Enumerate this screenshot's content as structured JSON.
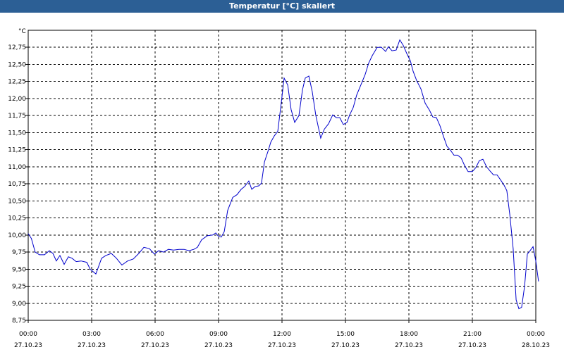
{
  "window": {
    "title": "Temperatur [°C] skaliert"
  },
  "chart_data": {
    "type": "line",
    "title": "Temperatur [°C] skaliert",
    "ylabel": "°C",
    "xlabel": "",
    "ylim": [
      8.75,
      13.0
    ],
    "xlim": [
      0,
      24
    ],
    "grid": true,
    "line_color": "#0000cc",
    "y_ticks": [
      {
        "value": 8.75,
        "label": "8,75"
      },
      {
        "value": 9.0,
        "label": "9,00"
      },
      {
        "value": 9.25,
        "label": "9,25"
      },
      {
        "value": 9.5,
        "label": "9,50"
      },
      {
        "value": 9.75,
        "label": "9,75"
      },
      {
        "value": 10.0,
        "label": "10,00"
      },
      {
        "value": 10.25,
        "label": "10,25"
      },
      {
        "value": 10.5,
        "label": "10,50"
      },
      {
        "value": 10.75,
        "label": "10,75"
      },
      {
        "value": 11.0,
        "label": "11,00"
      },
      {
        "value": 11.25,
        "label": "11,25"
      },
      {
        "value": 11.5,
        "label": "11,50"
      },
      {
        "value": 11.75,
        "label": "11,75"
      },
      {
        "value": 12.0,
        "label": "12,00"
      },
      {
        "value": 12.25,
        "label": "12,25"
      },
      {
        "value": 12.5,
        "label": "12,50"
      },
      {
        "value": 12.75,
        "label": "12,75"
      }
    ],
    "x_ticks": [
      {
        "value": 0,
        "time": "00:00",
        "date": "27.10.23"
      },
      {
        "value": 3,
        "time": "03:00",
        "date": "27.10.23"
      },
      {
        "value": 6,
        "time": "06:00",
        "date": "27.10.23"
      },
      {
        "value": 9,
        "time": "09:00",
        "date": "27.10.23"
      },
      {
        "value": 12,
        "time": "12:00",
        "date": "27.10.23"
      },
      {
        "value": 15,
        "time": "15:00",
        "date": "27.10.23"
      },
      {
        "value": 18,
        "time": "18:00",
        "date": "27.10.23"
      },
      {
        "value": 21,
        "time": "21:00",
        "date": "27.10.23"
      },
      {
        "value": 24,
        "time": "00:00",
        "date": "28.10.23"
      }
    ],
    "series": [
      {
        "points": [
          [
            0.0,
            10.02
          ],
          [
            0.15,
            9.95
          ],
          [
            0.33,
            9.75
          ],
          [
            0.53,
            9.71
          ],
          [
            0.77,
            9.71
          ],
          [
            1.0,
            9.77
          ],
          [
            1.17,
            9.73
          ],
          [
            1.33,
            9.62
          ],
          [
            1.5,
            9.7
          ],
          [
            1.7,
            9.57
          ],
          [
            1.9,
            9.68
          ],
          [
            2.07,
            9.66
          ],
          [
            2.27,
            9.61
          ],
          [
            2.5,
            9.62
          ],
          [
            2.77,
            9.6
          ],
          [
            2.93,
            9.5
          ],
          [
            3.2,
            9.43
          ],
          [
            3.47,
            9.66
          ],
          [
            3.67,
            9.7
          ],
          [
            3.93,
            9.73
          ],
          [
            4.17,
            9.66
          ],
          [
            4.43,
            9.56
          ],
          [
            4.7,
            9.62
          ],
          [
            4.97,
            9.65
          ],
          [
            5.23,
            9.73
          ],
          [
            5.47,
            9.82
          ],
          [
            5.73,
            9.8
          ],
          [
            5.97,
            9.72
          ],
          [
            6.17,
            9.77
          ],
          [
            6.4,
            9.75
          ],
          [
            6.63,
            9.79
          ],
          [
            6.87,
            9.78
          ],
          [
            7.13,
            9.79
          ],
          [
            7.37,
            9.79
          ],
          [
            7.6,
            9.77
          ],
          [
            7.83,
            9.79
          ],
          [
            8.0,
            9.82
          ],
          [
            8.2,
            9.93
          ],
          [
            8.47,
            9.99
          ],
          [
            8.73,
            10.0
          ],
          [
            8.87,
            10.03
          ],
          [
            9.0,
            9.98
          ],
          [
            9.13,
            9.97
          ],
          [
            9.27,
            10.05
          ],
          [
            9.43,
            10.36
          ],
          [
            9.67,
            10.55
          ],
          [
            9.87,
            10.59
          ],
          [
            10.07,
            10.67
          ],
          [
            10.23,
            10.71
          ],
          [
            10.43,
            10.79
          ],
          [
            10.57,
            10.67
          ],
          [
            10.73,
            10.71
          ],
          [
            10.9,
            10.72
          ],
          [
            11.03,
            10.76
          ],
          [
            11.17,
            11.07
          ],
          [
            11.33,
            11.22
          ],
          [
            11.47,
            11.36
          ],
          [
            11.63,
            11.45
          ],
          [
            11.8,
            11.52
          ],
          [
            11.97,
            11.95
          ],
          [
            12.1,
            12.3
          ],
          [
            12.27,
            12.2
          ],
          [
            12.43,
            11.84
          ],
          [
            12.6,
            11.65
          ],
          [
            12.8,
            11.75
          ],
          [
            12.97,
            12.13
          ],
          [
            13.1,
            12.3
          ],
          [
            13.27,
            12.33
          ],
          [
            13.43,
            12.1
          ],
          [
            13.6,
            11.75
          ],
          [
            13.83,
            11.42
          ],
          [
            14.0,
            11.55
          ],
          [
            14.2,
            11.63
          ],
          [
            14.4,
            11.76
          ],
          [
            14.57,
            11.72
          ],
          [
            14.73,
            11.72
          ],
          [
            14.9,
            11.62
          ],
          [
            15.07,
            11.65
          ],
          [
            15.2,
            11.76
          ],
          [
            15.37,
            11.87
          ],
          [
            15.53,
            12.05
          ],
          [
            15.73,
            12.2
          ],
          [
            15.93,
            12.35
          ],
          [
            16.1,
            12.52
          ],
          [
            16.27,
            12.63
          ],
          [
            16.5,
            12.75
          ],
          [
            16.7,
            12.75
          ],
          [
            16.9,
            12.69
          ],
          [
            17.03,
            12.76
          ],
          [
            17.2,
            12.7
          ],
          [
            17.4,
            12.71
          ],
          [
            17.57,
            12.86
          ],
          [
            17.73,
            12.78
          ],
          [
            17.9,
            12.66
          ],
          [
            18.07,
            12.55
          ],
          [
            18.2,
            12.4
          ],
          [
            18.37,
            12.26
          ],
          [
            18.57,
            12.14
          ],
          [
            18.77,
            11.93
          ],
          [
            18.97,
            11.83
          ],
          [
            19.13,
            11.73
          ],
          [
            19.3,
            11.72
          ],
          [
            19.47,
            11.6
          ],
          [
            19.63,
            11.45
          ],
          [
            19.8,
            11.3
          ],
          [
            19.97,
            11.24
          ],
          [
            20.13,
            11.17
          ],
          [
            20.3,
            11.17
          ],
          [
            20.47,
            11.13
          ],
          [
            20.63,
            11.02
          ],
          [
            20.8,
            10.93
          ],
          [
            21.0,
            10.93
          ],
          [
            21.17,
            10.99
          ],
          [
            21.33,
            11.09
          ],
          [
            21.5,
            11.11
          ],
          [
            21.67,
            11.0
          ],
          [
            21.83,
            10.94
          ],
          [
            22.0,
            10.88
          ],
          [
            22.17,
            10.88
          ],
          [
            22.33,
            10.81
          ],
          [
            22.5,
            10.73
          ],
          [
            22.63,
            10.65
          ],
          [
            22.77,
            10.3
          ],
          [
            22.93,
            9.8
          ],
          [
            23.07,
            9.05
          ],
          [
            23.2,
            8.92
          ],
          [
            23.33,
            8.94
          ],
          [
            23.47,
            9.25
          ],
          [
            23.6,
            9.72
          ],
          [
            23.73,
            9.77
          ],
          [
            23.87,
            9.83
          ],
          [
            24.0,
            9.62
          ],
          [
            24.13,
            9.32
          ]
        ]
      }
    ]
  }
}
